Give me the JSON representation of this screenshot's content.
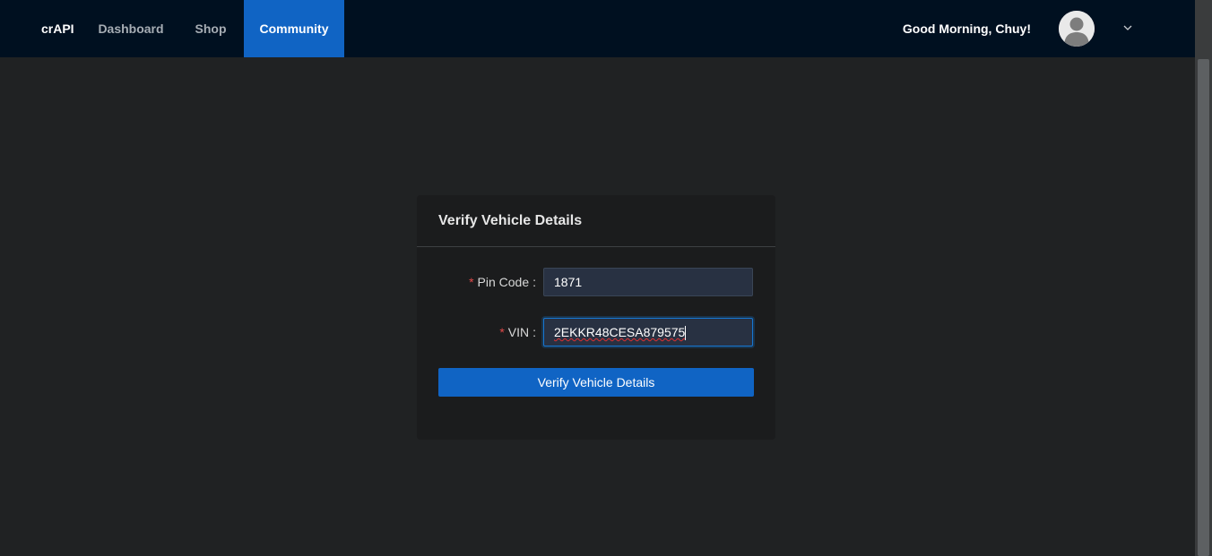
{
  "nav": {
    "brand": "crAPI",
    "items": [
      {
        "label": "Dashboard",
        "active": false
      },
      {
        "label": "Shop",
        "active": false
      },
      {
        "label": "Community",
        "active": true
      }
    ],
    "greeting": "Good Morning, Chuy!",
    "avatar_icon": "user-avatar-icon",
    "menu_icon": "chevron-down-icon"
  },
  "form": {
    "title": "Verify Vehicle Details",
    "pin": {
      "label": "Pin Code",
      "value": "1871"
    },
    "vin": {
      "label": "VIN",
      "value": "2EKKR48CESA879575"
    },
    "submit_label": "Verify Vehicle Details"
  },
  "colors": {
    "navbar_bg": "#001020",
    "accent": "#1064c4",
    "page_bg": "#202223",
    "card_bg": "#1b1c1d",
    "required_mark": "#e04a4a"
  }
}
